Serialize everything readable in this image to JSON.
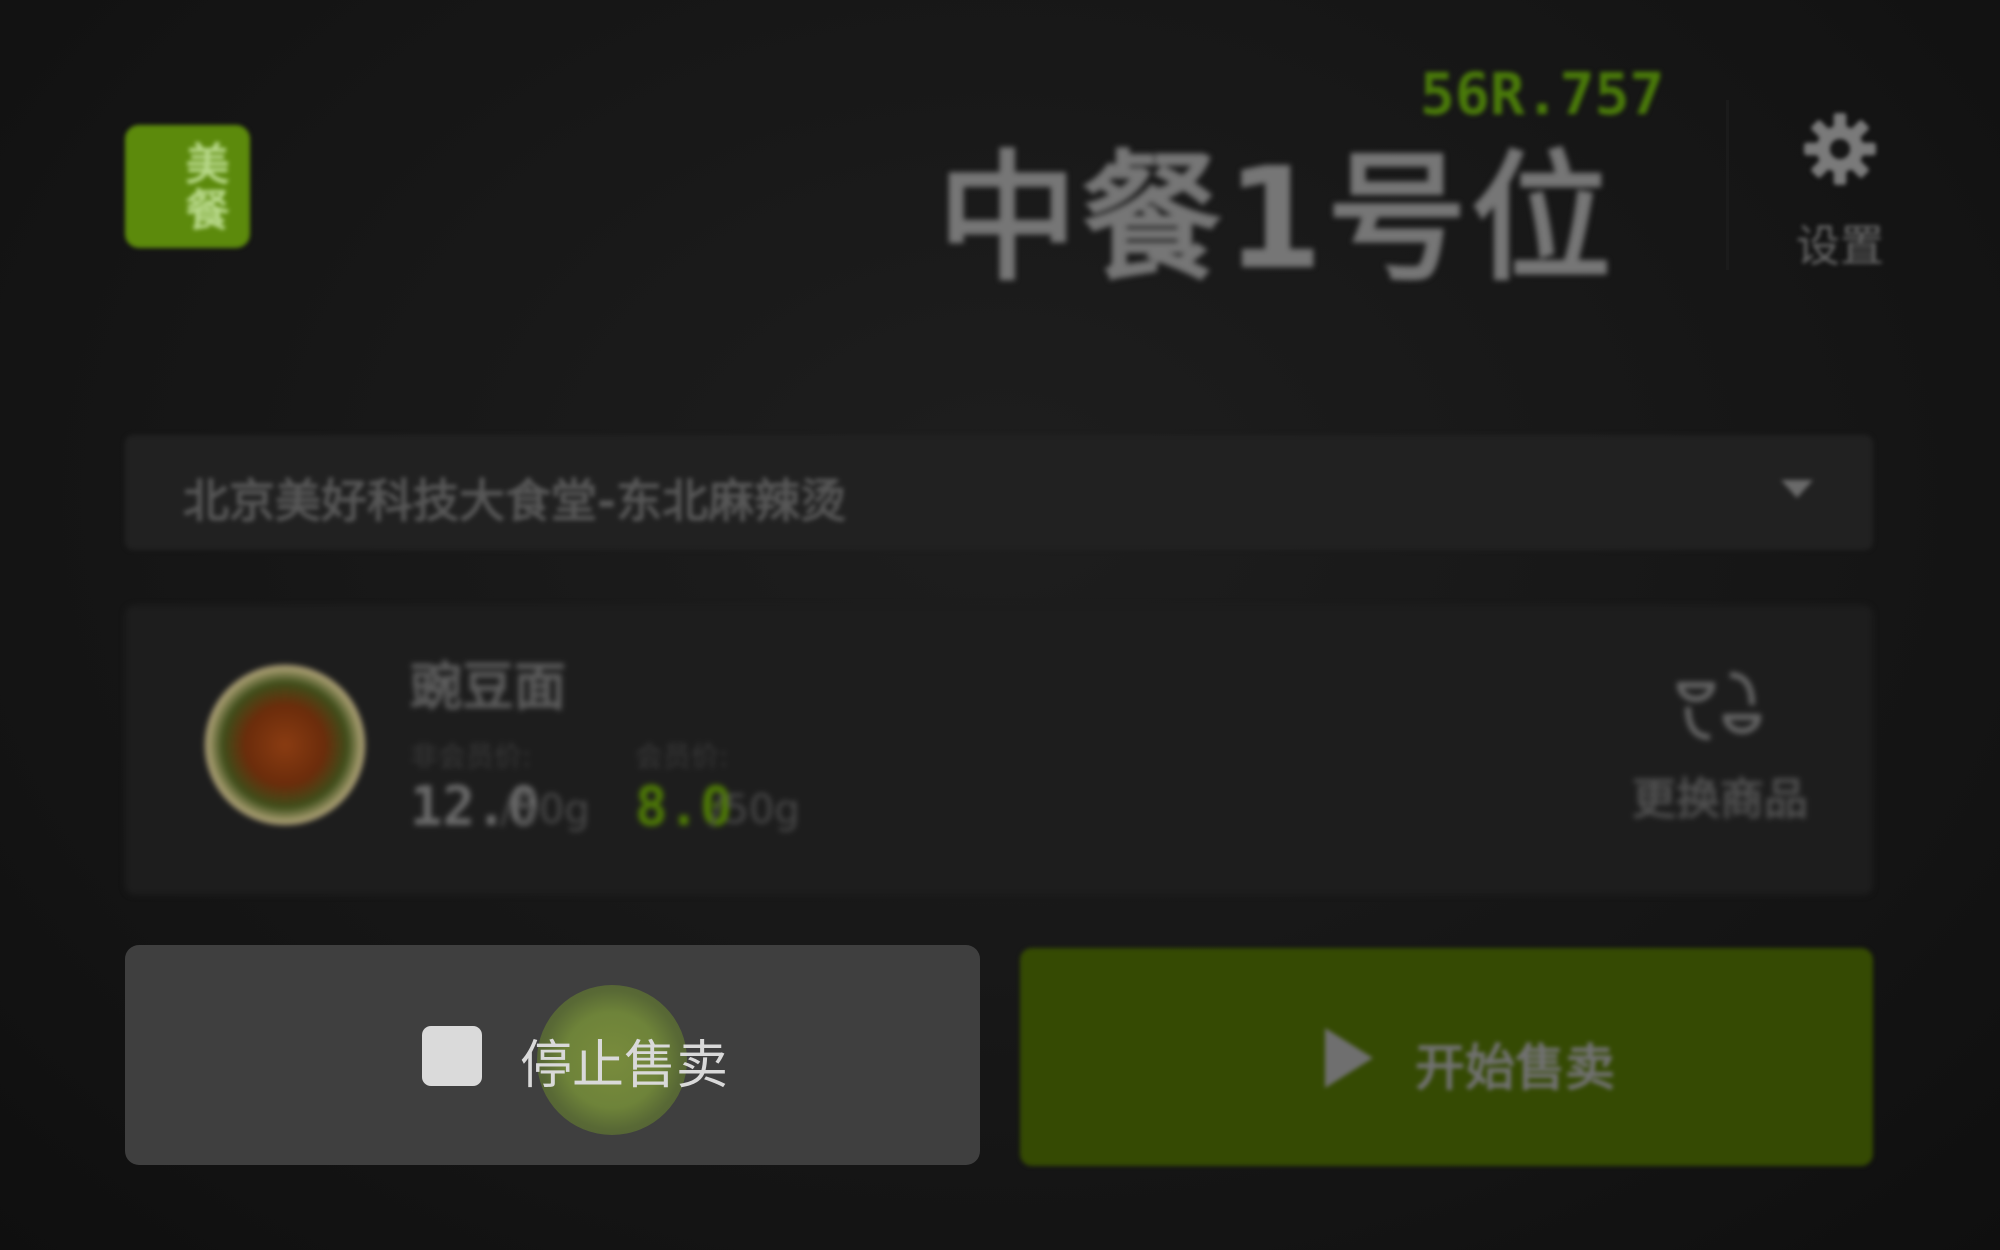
{
  "header": {
    "logo_text": "美餐",
    "device_code": "56R.757",
    "station_title": "中餐1号位",
    "settings_label": "设置",
    "settings_icon": "gear-icon"
  },
  "store_select": {
    "value": "北京美好科技大食堂-东北麻辣烫",
    "caret_icon": "chevron-down-icon"
  },
  "product": {
    "name": "豌豆面",
    "regular_price_label": "非会员价:",
    "regular_price": "12.0",
    "regular_unit": "/50g",
    "member_price_label": "会员价:",
    "member_price": "8.0",
    "member_unit": "/50g",
    "swap_label": "更换商品",
    "swap_icon": "swap-bowls-icon"
  },
  "actions": {
    "stop_label": "停止售卖",
    "stop_icon": "stop-square-icon",
    "start_label": "开始售卖",
    "start_icon": "play-icon"
  },
  "colors": {
    "accent_green": "#5c8a0c",
    "start_button": "#354a03",
    "stop_button": "#3f3f3f",
    "member_price": "#4f7c05"
  }
}
